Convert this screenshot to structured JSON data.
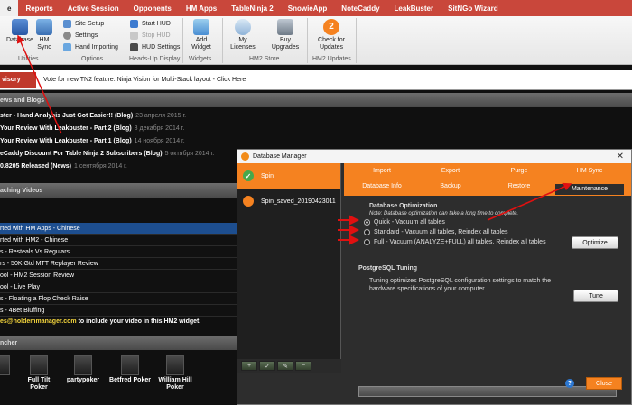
{
  "menu": {
    "items": [
      "e",
      "Reports",
      "Active Session",
      "Opponents",
      "HM Apps",
      "TableNinja 2",
      "SnowieApp",
      "NoteCaddy",
      "LeakBuster",
      "SitNGo Wizard"
    ]
  },
  "ribbon": {
    "database": "Database",
    "hm_sync": "HM Sync",
    "site_setup": "Site Setup",
    "settings": "Settings",
    "hand_importing": "Hand Importing",
    "start_hud": "Start HUD",
    "stop_hud": "Stop HUD",
    "hud_settings": "HUD Settings",
    "add_widget": "Add Widget",
    "my_licenses": "My Licenses",
    "buy_upgrades": "Buy Upgrades",
    "check_updates": "Check for Updates",
    "update_badge": "2",
    "group_utilities": "Utilities",
    "group_options": "Options",
    "group_hud": "Heads-Up Display",
    "group_widgets": "Widgets",
    "group_store": "HM2 Store",
    "group_updates": "HM2 Updates"
  },
  "advisory": {
    "tag": "visory",
    "text": "Vote for new TN2 feature: Ninja Vision for Multi-Stack layout - Click Here"
  },
  "news": {
    "heading": "ews and Blogs",
    "items": [
      {
        "title": "ster - Hand Analysis Just Got Easier!! (Blog)",
        "date": "23 апреля 2015 г."
      },
      {
        "title": "Your Review With Leakbuster - Part 2 (Blog)",
        "date": "8 декабря 2014 г."
      },
      {
        "title": "Your Review With Leakbuster - Part 1 (Blog)",
        "date": "14 ноября 2014 г."
      },
      {
        "title": "eCaddy Discount For Table Ninja 2 Subscribers (Blog)",
        "date": "5 октября 2014 г."
      },
      {
        "title": "0.8205 Released (News)",
        "date": "1 сентября 2014 г."
      }
    ]
  },
  "videos": {
    "heading": "aching Videos",
    "items": [
      "rted with HM Apps - Chinese",
      "rted with HM2 - Chinese",
      "s - Resteals Vs Regulars",
      "rs - 50K Gtd MTT Replayer Review",
      "ool - HM2 Session Review",
      "ool - Live Play",
      "s - Floating a Flop Check Raise",
      "s - 4Bet Bluffing"
    ],
    "footer_email": "es@holdemmanager.com",
    "footer_text": " to include your video in this HM2 widget."
  },
  "launcher": {
    "heading": "ncher",
    "items": [
      "Full Tilt Poker",
      "partypoker",
      "Betfred Poker",
      "William Hill Poker"
    ]
  },
  "dialog": {
    "title": "Database Manager",
    "databases": [
      "Spin",
      "Spin_saved_20190423011"
    ],
    "tabs_row1": [
      "Import",
      "Export",
      "Purge",
      "HM Sync"
    ],
    "tabs_row2": [
      "Database Info",
      "Backup",
      "Restore",
      "Maintenance"
    ],
    "opt_heading": "Database Optimization",
    "opt_note": "Note: Database optimization can take a long time to complete.",
    "options": [
      "Quick - Vacuum all tables",
      "Standard - Vacuum all tables, Reindex all tables",
      "Full - Vacuum (ANALYZE+FULL) all tables, Reindex all tables"
    ],
    "optimize_button": "Optimize",
    "tuning_heading": "PostgreSQL Tuning",
    "tuning_text": "Tuning optimizes PostgreSQL configuration settings to match the hardware specifications of your computer.",
    "tune_button": "Tune",
    "help": "?",
    "close_button": "Close"
  },
  "colors": {
    "accent": "#f58220",
    "menu": "#c9473b",
    "selected_row": "#1d4e8f",
    "arrow": "#e01010"
  }
}
